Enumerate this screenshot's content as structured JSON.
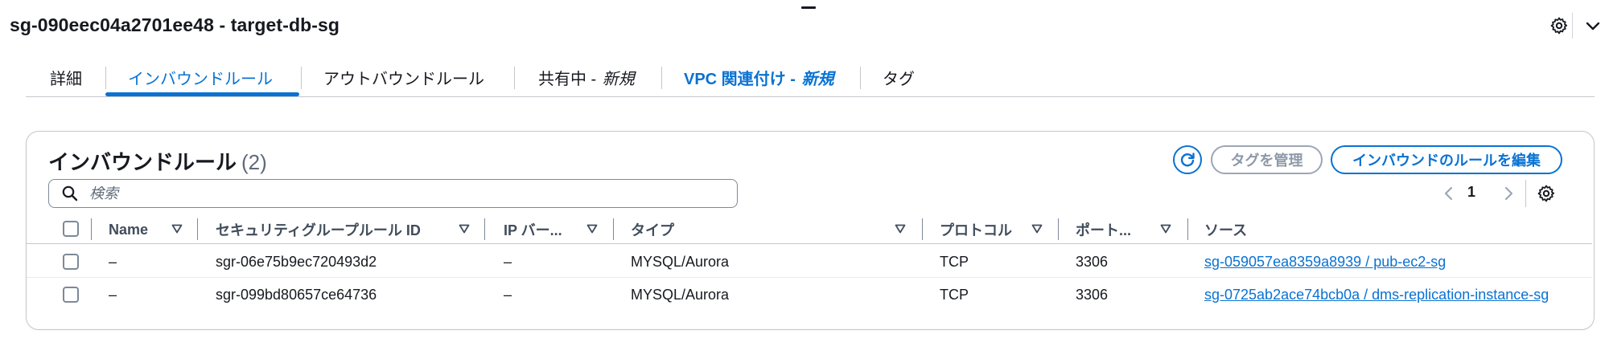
{
  "header": {
    "title": "sg-090eec04a2701ee48 - target-db-sg",
    "icons": [
      "gear-icon",
      "chevron-down-icon"
    ]
  },
  "tabs": [
    {
      "label": "詳細"
    },
    {
      "label": "インバウンドルール",
      "active": true
    },
    {
      "label": "アウトバウンドルール"
    },
    {
      "label": "共有中 - ",
      "badge": "新規"
    },
    {
      "label": "VPC 関連付け - ",
      "badge": "新規"
    },
    {
      "label": "タグ"
    }
  ],
  "panel": {
    "title": "インバウンドルール",
    "count": "(2)",
    "manage_tags_label": "タグを管理",
    "edit_rules_label": "インバウンドのルールを編集",
    "search_placeholder": "検索",
    "page": "1"
  },
  "table": {
    "columns": [
      "Name",
      "セキュリティグループルール ID",
      "IP バー...",
      "タイプ",
      "プロトコル",
      "ポート...",
      "ソース"
    ],
    "rows": [
      {
        "name": "–",
        "rule_id": "sgr-06e75b9ec720493d2",
        "ip_version": "–",
        "type": "MYSQL/Aurora",
        "protocol": "TCP",
        "port": "3306",
        "source": "sg-059057ea8359a8939 / pub-ec2-sg"
      },
      {
        "name": "–",
        "rule_id": "sgr-099bd80657ce64736",
        "ip_version": "–",
        "type": "MYSQL/Aurora",
        "protocol": "TCP",
        "port": "3306",
        "source": "sg-0725ab2ace74bcb0a / dms-replication-instance-sg"
      }
    ]
  },
  "colors": {
    "accent": "#0972d3",
    "text": "#16191f",
    "muted": "#5f6b7a",
    "border": "#c6c6cd",
    "disabled": "#9ba7b6"
  }
}
